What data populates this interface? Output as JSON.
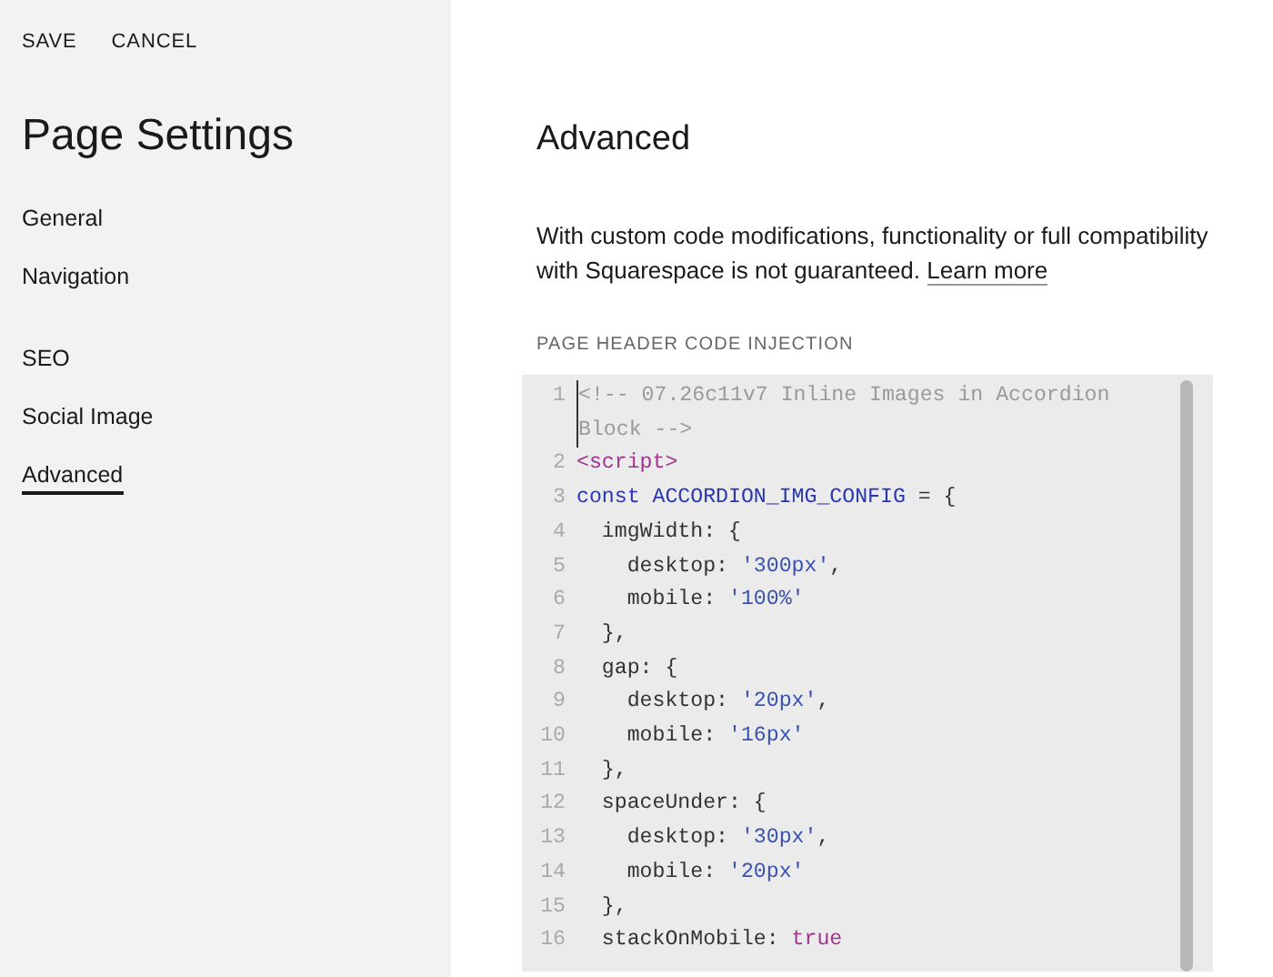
{
  "toolbar": {
    "buttons": [
      "SAVE",
      "CANCEL"
    ]
  },
  "sidebar": {
    "title": "Page Settings",
    "groups": [
      [
        {
          "label": "General",
          "selected": false
        },
        {
          "label": "Navigation",
          "selected": false
        }
      ],
      [
        {
          "label": "SEO",
          "selected": false
        },
        {
          "label": "Social Image",
          "selected": false
        },
        {
          "label": "Advanced",
          "selected": true
        }
      ]
    ]
  },
  "main": {
    "title": "Advanced",
    "description": "With custom code modifications, functionality or full compatibility with Squarespace is not guaranteed.",
    "link": "Learn more",
    "section_label": "PAGE HEADER CODE INJECTION",
    "code_lines": [
      {
        "number": "1",
        "tokens": [
          {
            "kind": "comment",
            "text": "<!-- 07.26c11v7 Inline Images in Accordion Block -->"
          }
        ]
      },
      {
        "number": "2",
        "tokens": [
          {
            "kind": "tag",
            "text": "<script>"
          }
        ]
      },
      {
        "number": "3",
        "tokens": [
          {
            "kind": "keyword",
            "text": "const"
          },
          {
            "kind": "variable",
            "text": "ACCORDION_IMG_CONFIG",
            "space_before": true
          },
          {
            "kind": "plain",
            "text": " = {"
          }
        ]
      },
      {
        "number": "4",
        "tokens": [
          {
            "kind": "plain",
            "text": "  imgWidth: {"
          }
        ]
      },
      {
        "number": "5",
        "tokens": [
          {
            "kind": "plain",
            "text": "    desktop: "
          },
          {
            "kind": "string",
            "text": "'300px'"
          },
          {
            "kind": "plain",
            "text": ","
          }
        ]
      },
      {
        "number": "6",
        "tokens": [
          {
            "kind": "plain",
            "text": "    mobile: "
          },
          {
            "kind": "string",
            "text": "'100%'"
          }
        ]
      },
      {
        "number": "7",
        "tokens": [
          {
            "kind": "plain",
            "text": "  },"
          }
        ]
      },
      {
        "number": "8",
        "tokens": [
          {
            "kind": "plain",
            "text": "  gap: {"
          }
        ]
      },
      {
        "number": "9",
        "tokens": [
          {
            "kind": "plain",
            "text": "    desktop: "
          },
          {
            "kind": "string",
            "text": "'20px'"
          },
          {
            "kind": "plain",
            "text": ","
          }
        ]
      },
      {
        "number": "10",
        "tokens": [
          {
            "kind": "plain",
            "text": "    mobile: "
          },
          {
            "kind": "string",
            "text": "'16px'"
          }
        ]
      },
      {
        "number": "11",
        "tokens": [
          {
            "kind": "plain",
            "text": "  },"
          }
        ]
      },
      {
        "number": "12",
        "tokens": [
          {
            "kind": "plain",
            "text": "  spaceUnder: {"
          }
        ]
      },
      {
        "number": "13",
        "tokens": [
          {
            "kind": "plain",
            "text": "    desktop: "
          },
          {
            "kind": "string",
            "text": "'30px'"
          },
          {
            "kind": "plain",
            "text": ","
          }
        ]
      },
      {
        "number": "14",
        "tokens": [
          {
            "kind": "plain",
            "text": "    mobile: "
          },
          {
            "kind": "string",
            "text": "'20px'"
          }
        ]
      },
      {
        "number": "15",
        "tokens": [
          {
            "kind": "plain",
            "text": "  },"
          }
        ]
      },
      {
        "number": "16",
        "tokens": [
          {
            "kind": "plain",
            "text": "  stackOnMobile: "
          },
          {
            "kind": "atom",
            "text": "true"
          }
        ]
      }
    ]
  }
}
